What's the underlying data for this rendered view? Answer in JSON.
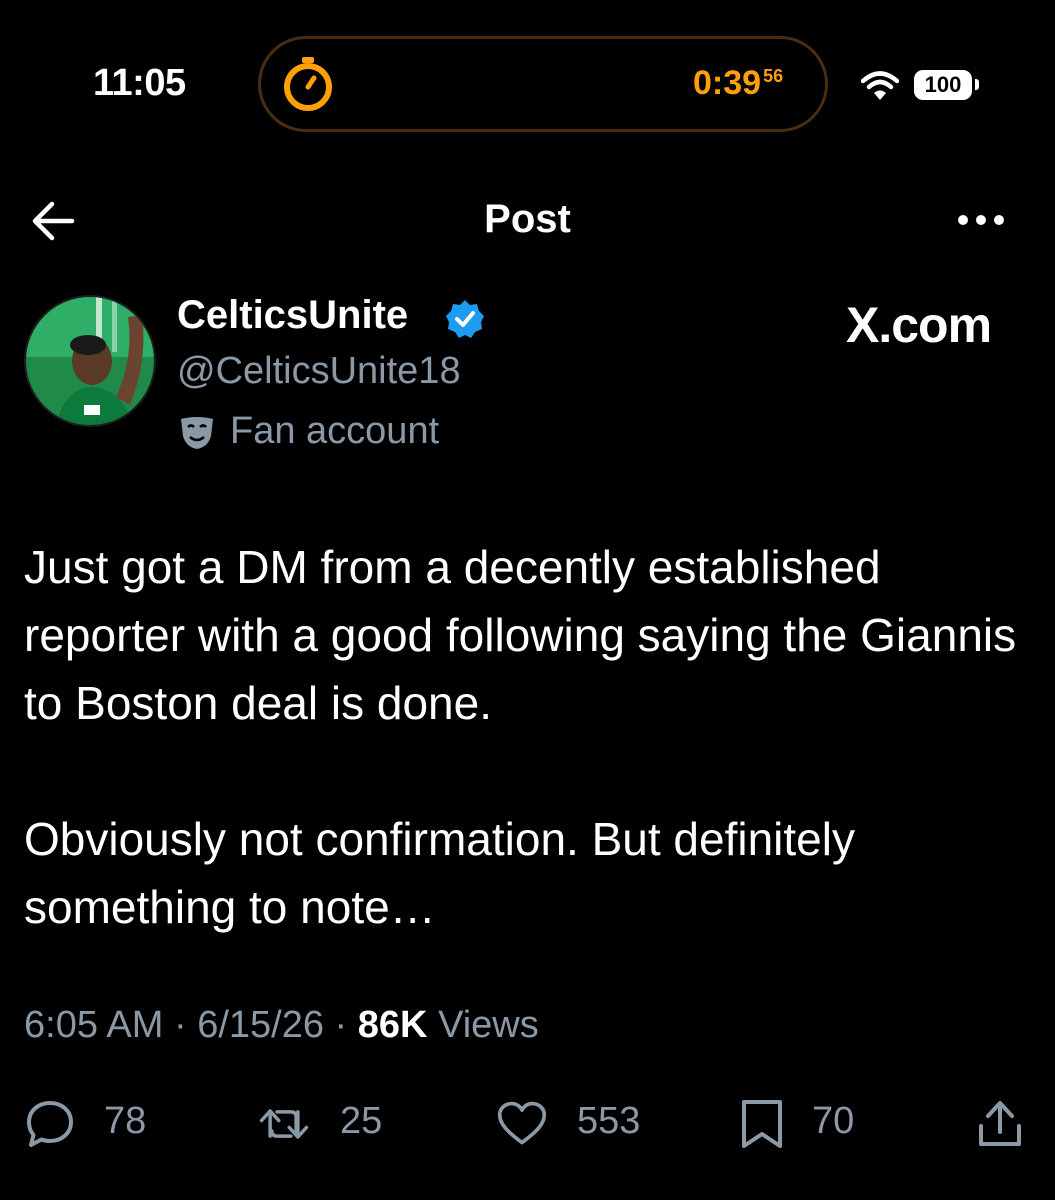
{
  "status_bar": {
    "time": "11:05",
    "timer": "0:39",
    "timer_sub": "56",
    "battery": "100",
    "accent": "#ff9f0a"
  },
  "nav": {
    "title": "Post",
    "back_icon": "arrow-left-icon",
    "more_icon": "more-horizontal-icon"
  },
  "profile": {
    "name": "CelticsUnite",
    "handle": "@CelticsUnite18",
    "label": "Fan account",
    "verified_color": "#1d9bf0"
  },
  "watermark": "X.com",
  "post": {
    "text": "Just got a DM from a decently established reporter with a good following saying the Giannis to Boston deal is done.\n\nObviously not confirmation. But definitely something to note…",
    "time": "6:05 AM",
    "date": "6/15/26",
    "views_count": "86K",
    "views_label": "Views"
  },
  "actions": {
    "replies": "78",
    "reposts": "25",
    "likes": "553",
    "bookmarks": "70"
  }
}
